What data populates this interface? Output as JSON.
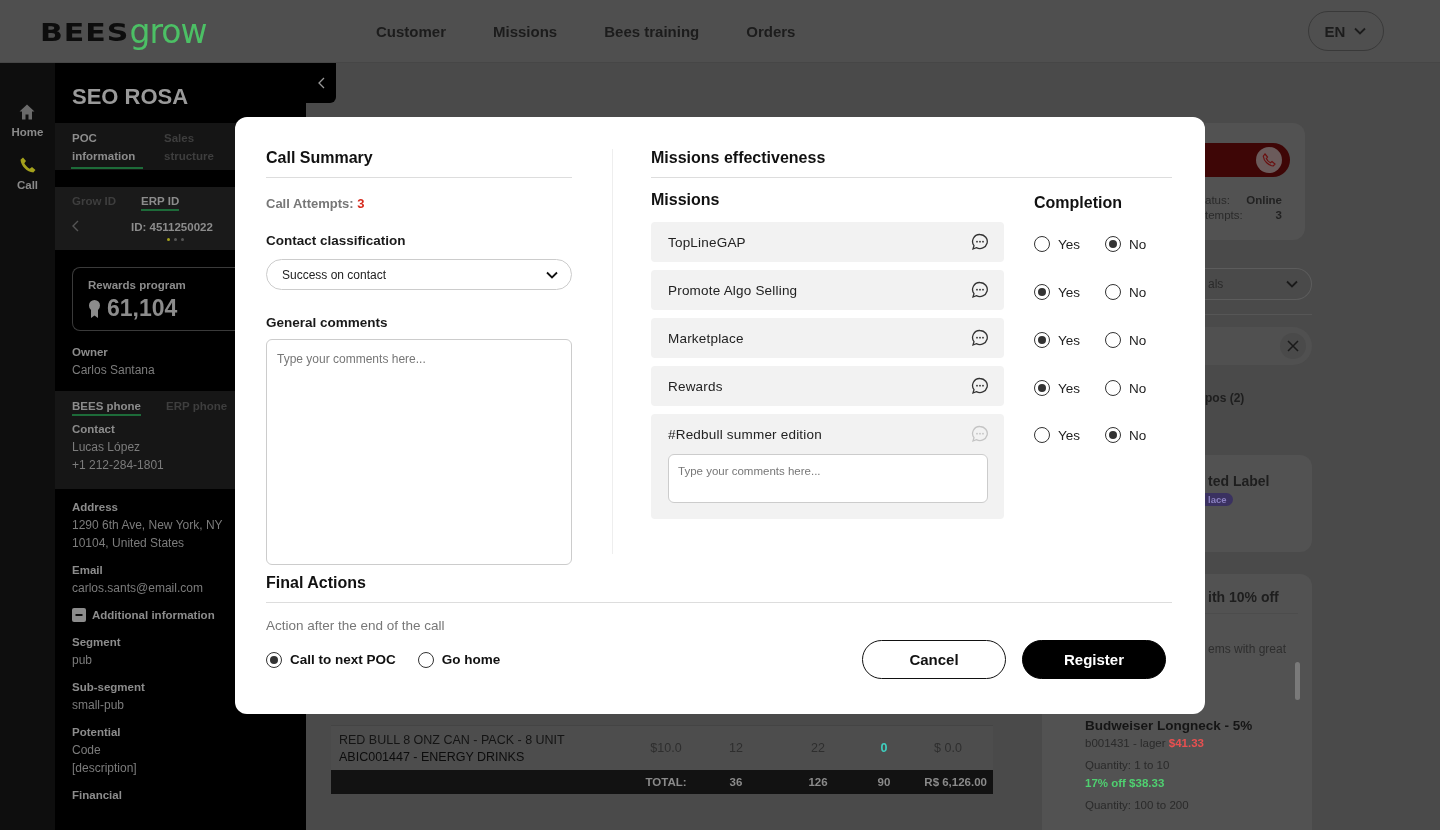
{
  "header": {
    "logo": {
      "brand": "BEES",
      "product": "grow"
    },
    "nav": [
      {
        "label": "Customer"
      },
      {
        "label": "Missions"
      },
      {
        "label": "Bees training"
      },
      {
        "label": "Orders"
      }
    ],
    "language": "EN"
  },
  "rail": [
    {
      "kind": "home",
      "label": "Home",
      "selected": false
    },
    {
      "kind": "call",
      "label": "Call",
      "selected": true
    }
  ],
  "poc": {
    "name": "SEO ROSA",
    "tabs": [
      {
        "label": "POC information",
        "selected": true
      },
      {
        "label": "Sales structure",
        "selected": false
      }
    ],
    "id_tabs": [
      {
        "label": "Grow ID",
        "selected": false
      },
      {
        "label": "ERP ID",
        "selected": true
      }
    ],
    "id_value": "ID: 4511250022",
    "id_pages": [
      {
        "selected": true
      },
      {
        "selected": false
      },
      {
        "selected": false
      }
    ],
    "rewards": {
      "title": "Rewards program",
      "points": "61,104"
    },
    "owner": {
      "label": "Owner",
      "value": "Carlos Santana"
    },
    "phone_tabs": [
      {
        "label": "BEES phone",
        "selected": true
      },
      {
        "label": "ERP phone",
        "selected": false
      }
    ],
    "contact": {
      "label": "Contact",
      "name": "Lucas López",
      "phone": "+1 212-284-1801"
    },
    "details": [
      {
        "label": "Address",
        "value": "1290 6th Ave, New York, NY 10104, United States"
      },
      {
        "label": "Email",
        "value": "carlos.sants@email.com"
      }
    ],
    "additional": {
      "title": "Additional information",
      "expanded": true,
      "fields": [
        {
          "label": "Segment",
          "value": "pub"
        },
        {
          "label": "Sub-segment",
          "value": "small-pub"
        },
        {
          "label": "Potential",
          "value": "Code\n[description]"
        },
        {
          "label": "Financial"
        }
      ]
    }
  },
  "main": {
    "table": {
      "rows": [
        {
          "name": "RED BULL 8 ONZ CAN - PACK - 8 UNIT",
          "sku": "ABIC001447 - ENERGY DRINKS",
          "cells": [
            "$10.0",
            "12",
            "22",
            "0",
            "$ 0.0"
          ]
        }
      ],
      "total": {
        "label": "TOTAL:",
        "cells": [
          "36",
          "126",
          "90",
          "R$ 6,126.00"
        ]
      }
    },
    "call_card": {
      "status_label": "atus:",
      "status": "Online",
      "attempts_label": "tempts:",
      "attempts": "3"
    },
    "filter_select": "als",
    "combos_tab": "pos (2)",
    "label_card": {
      "title": "ted Label",
      "badge": "lace"
    },
    "offer_card": {
      "title": "ith 10% off",
      "description": "ems with great",
      "products": [
        {
          "name": "Budweiser Longneck - 5%",
          "sku": "b001431 - lager",
          "price": "$41.33",
          "tiers": [
            {
              "quantity": "Quantity: 1 to 10",
              "discount": "17% off",
              "price": "$38.33"
            },
            {
              "quantity": "Quantity: 100 to 200"
            }
          ]
        }
      ]
    }
  },
  "modal": {
    "summary": {
      "title": "Call Summary",
      "attempts_label": "Call Attempts:",
      "attempts": "3",
      "classification_label": "Contact classification",
      "classification": "Success on contact",
      "comments_label": "General comments",
      "comments_placeholder": "Type your comments here..."
    },
    "missions": {
      "title": "Missions effectiveness",
      "missions_label": "Missions",
      "completion_label": "Completion",
      "items": [
        {
          "name": "TopLineGAP",
          "expanded": false,
          "options": [
            {
              "label": "Yes",
              "selected": false
            },
            {
              "label": "No",
              "selected": true
            }
          ]
        },
        {
          "name": "Promote Algo Selling",
          "expanded": false,
          "options": [
            {
              "label": "Yes",
              "selected": true
            },
            {
              "label": "No",
              "selected": false
            }
          ]
        },
        {
          "name": "Marketplace",
          "expanded": false,
          "options": [
            {
              "label": "Yes",
              "selected": true
            },
            {
              "label": "No",
              "selected": false
            }
          ]
        },
        {
          "name": "Rewards",
          "expanded": false,
          "options": [
            {
              "label": "Yes",
              "selected": true
            },
            {
              "label": "No",
              "selected": false
            }
          ]
        },
        {
          "name": "#Redbull summer edition",
          "expanded": true,
          "comment_placeholder": "Type your comments here...",
          "options": [
            {
              "label": "Yes",
              "selected": false
            },
            {
              "label": "No",
              "selected": true
            }
          ]
        }
      ]
    },
    "final": {
      "title": "Final Actions",
      "hint": "Action after the end of the call",
      "options": [
        {
          "label": "Call to next POC",
          "selected": true
        },
        {
          "label": "Go home",
          "selected": false
        }
      ],
      "buttons": [
        {
          "kind": "secondary",
          "label": "Cancel"
        },
        {
          "kind": "primary",
          "label": "Register"
        }
      ]
    }
  }
}
